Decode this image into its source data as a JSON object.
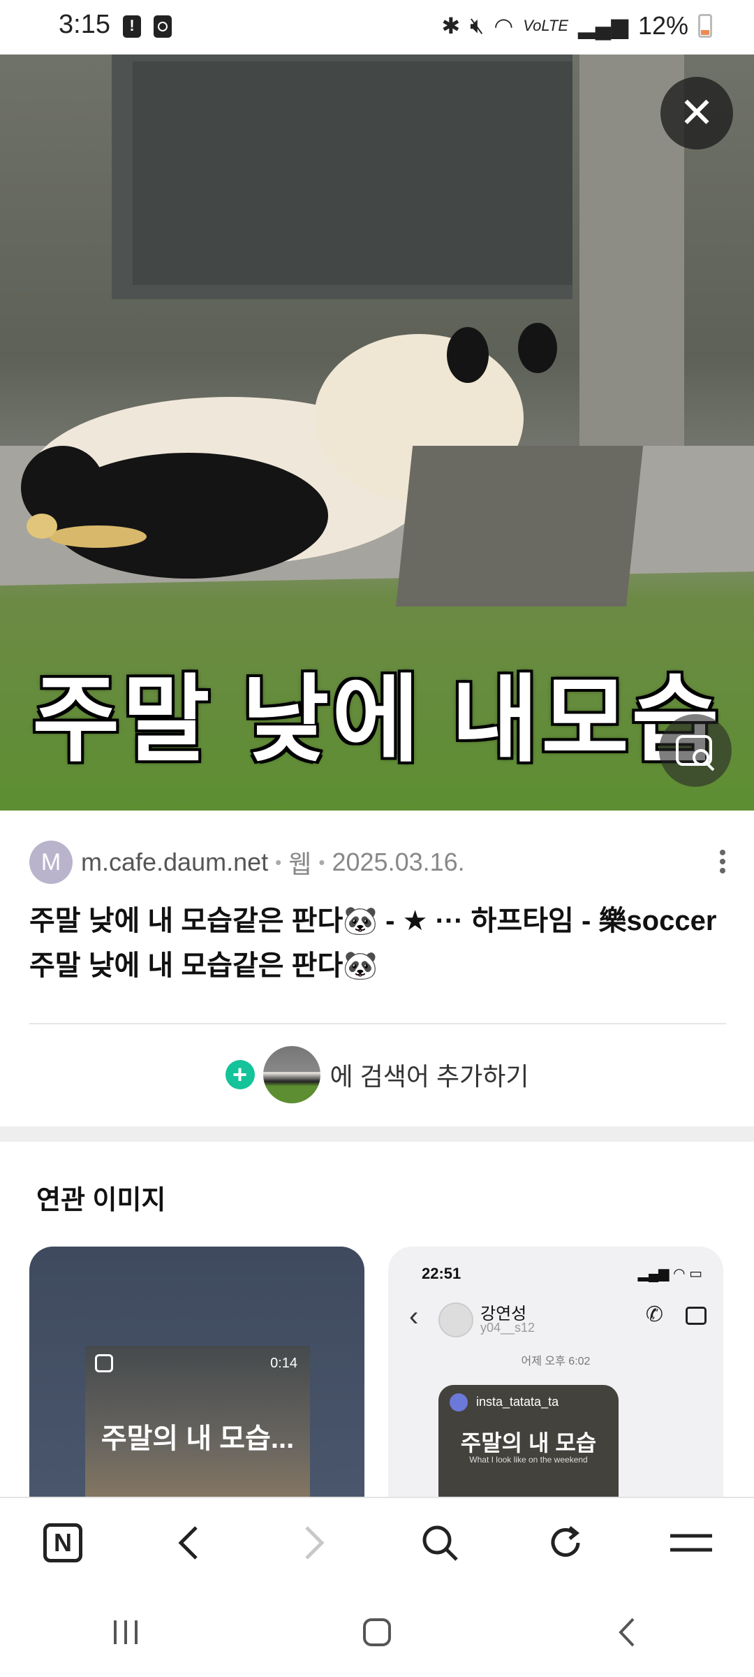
{
  "status_bar": {
    "time": "3:15",
    "network": "VoLTE",
    "battery": "12%"
  },
  "hero": {
    "caption": "주말 낮에 내모습",
    "close_icon": "close-icon",
    "lens_icon": "image-search-icon"
  },
  "result": {
    "favicon_letter": "M",
    "domain": "m.cafe.daum.net",
    "type": "웹",
    "date": "2025.03.16.",
    "title": "주말 낮에 내 모습같은 판다🐼 - ★ ··· 하프타임 - 樂soccer 주말 낮에 내 모습같은 판다🐼"
  },
  "add_search": {
    "plus": "+",
    "label": "에 검색어 추가하기"
  },
  "related": {
    "title": "연관 이미지",
    "cards": [
      {
        "video_duration": "0:14",
        "caption": "주말의 내 모습..."
      },
      {
        "time": "22:51",
        "contact_name": "강연성",
        "contact_handle": "y04__s12",
        "date_label": "어제 오후 6:02",
        "ig_user": "insta_tatata_ta",
        "big_text": "주말의 내 모습",
        "sub_text": "What I look like on the weekend"
      }
    ]
  },
  "bottom_bar": {
    "home_label": "N"
  },
  "colors": {
    "accent_green": "#14c39a",
    "favicon_purple": "#b9b4cc"
  }
}
